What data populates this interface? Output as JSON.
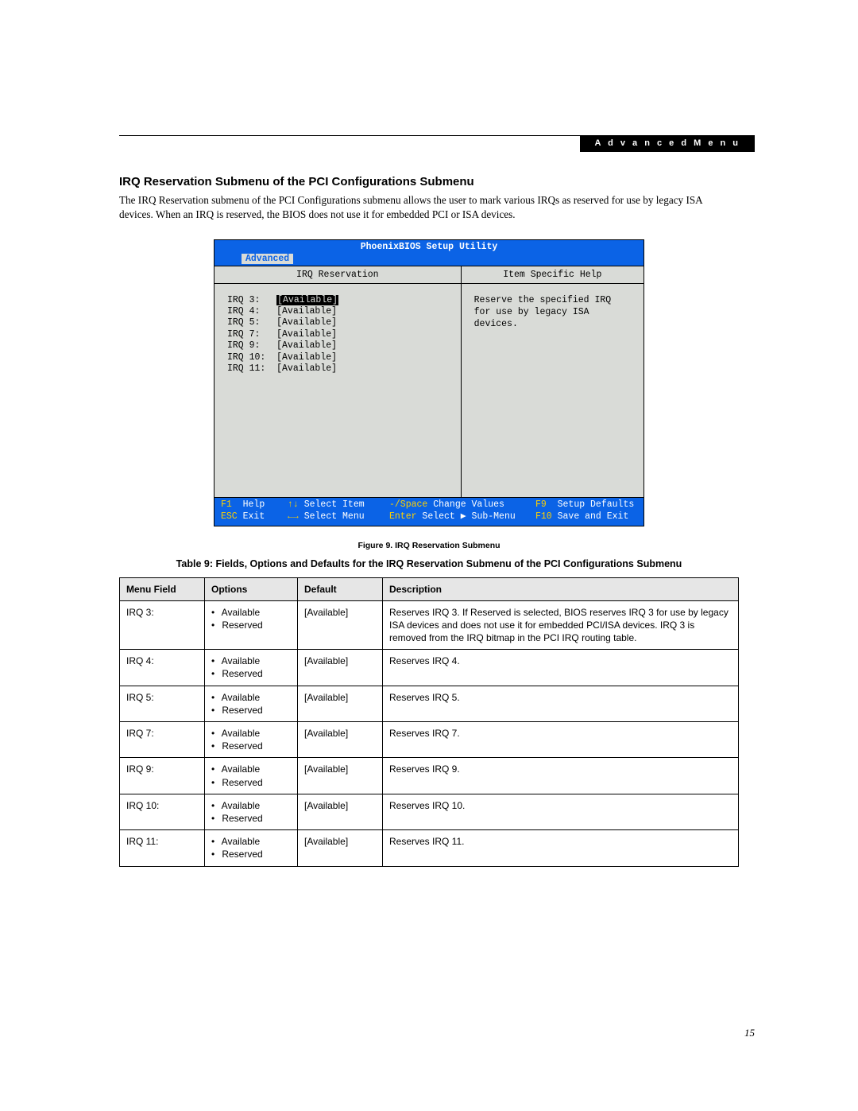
{
  "header": {
    "tag": "A d v a n c e d   M e n u"
  },
  "section": {
    "title": "IRQ Reservation Submenu of the PCI Configurations Submenu",
    "paragraph": "The IRQ Reservation submenu of the PCI Configurations submenu allows the user to mark various IRQs as reserved for use by legacy ISA devices. When an IRQ is reserved, the BIOS does not use it for embedded PCI or ISA devices."
  },
  "bios": {
    "title": "PhoenixBIOS Setup Utility",
    "menubar_active": "Advanced",
    "left_header": "IRQ Reservation",
    "right_header": "Item Specific Help",
    "rows": [
      {
        "label": "IRQ 3:",
        "value": "[Available]",
        "selected": true
      },
      {
        "label": "IRQ 4:",
        "value": "[Available]",
        "selected": false
      },
      {
        "label": "IRQ 5:",
        "value": "[Available]",
        "selected": false
      },
      {
        "label": "IRQ 7:",
        "value": "[Available]",
        "selected": false
      },
      {
        "label": "IRQ 9:",
        "value": "[Available]",
        "selected": false
      },
      {
        "label": "IRQ 10:",
        "value": "[Available]",
        "selected": false
      },
      {
        "label": "IRQ 11:",
        "value": "[Available]",
        "selected": false
      }
    ],
    "help_text": "Reserve the specified IRQ for use by legacy ISA devices.",
    "footer": {
      "line1": {
        "k1": "F1",
        "t1": "Help",
        "k2": "↑↓",
        "t2": "Select Item",
        "k3": "-/Space",
        "t3": "Change Values",
        "k4": "F9",
        "t4": "Setup Defaults"
      },
      "line2": {
        "k1": "ESC",
        "t1": "Exit",
        "k2": "←→",
        "t2": "Select Menu",
        "k3": "Enter",
        "t3": "Select ▶ Sub-Menu",
        "k4": "F10",
        "t4": "Save and Exit"
      }
    }
  },
  "figure_caption": "Figure 9.  IRQ Reservation Submenu",
  "table_caption": "Table 9: Fields, Options and Defaults for the IRQ Reservation Submenu of the PCI Configurations Submenu",
  "table": {
    "headers": [
      "Menu Field",
      "Options",
      "Default",
      "Description"
    ],
    "option_pair": [
      "Available",
      "Reserved"
    ],
    "rows": [
      {
        "field": "IRQ 3:",
        "default": "[Available]",
        "desc": "Reserves IRQ 3. If Reserved is selected, BIOS reserves IRQ 3 for use by legacy ISA devices and does not use it for embedded PCI/ISA devices. IRQ 3 is removed from the IRQ bitmap in the PCI IRQ routing table."
      },
      {
        "field": "IRQ 4:",
        "default": "[Available]",
        "desc": "Reserves IRQ 4."
      },
      {
        "field": "IRQ 5:",
        "default": "[Available]",
        "desc": "Reserves IRQ 5."
      },
      {
        "field": "IRQ 7:",
        "default": "[Available]",
        "desc": "Reserves IRQ 7."
      },
      {
        "field": "IRQ 9:",
        "default": "[Available]",
        "desc": "Reserves IRQ 9."
      },
      {
        "field": "IRQ 10:",
        "default": "[Available]",
        "desc": "Reserves IRQ 10."
      },
      {
        "field": "IRQ 11:",
        "default": "[Available]",
        "desc": "Reserves IRQ 11."
      }
    ]
  },
  "page_number": "15"
}
